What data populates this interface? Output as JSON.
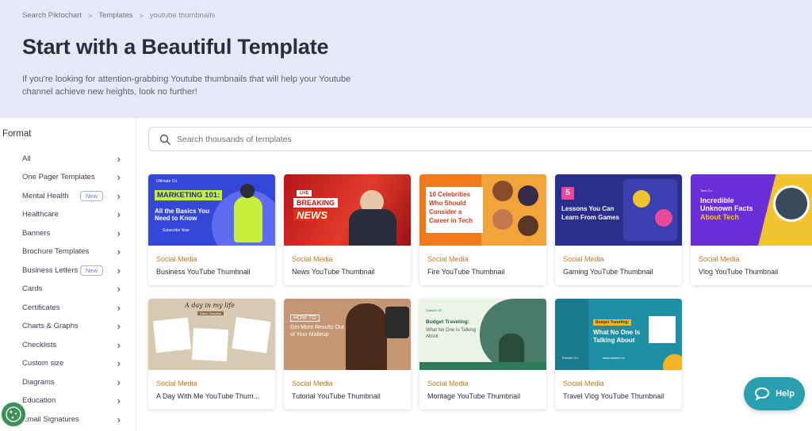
{
  "breadcrumb": {
    "items": [
      "Search Piktochart",
      "Templates",
      "youtube thumbnails"
    ]
  },
  "hero": {
    "title": "Start with a Beautiful Template",
    "description": "If you're looking for attention-grabbing Youtube thumbnails that will help your Youtube channel achieve new heights, look no further!"
  },
  "sidebar": {
    "heading": "Format",
    "items": [
      {
        "label": "All",
        "badge": ""
      },
      {
        "label": "One Pager Templates",
        "badge": ""
      },
      {
        "label": "Mental Health",
        "badge": "New"
      },
      {
        "label": "Healthcare",
        "badge": ""
      },
      {
        "label": "Banners",
        "badge": ""
      },
      {
        "label": "Brochure Templates",
        "badge": ""
      },
      {
        "label": "Business Letters",
        "badge": "New"
      },
      {
        "label": "Cards",
        "badge": ""
      },
      {
        "label": "Certificates",
        "badge": ""
      },
      {
        "label": "Charts & Graphs",
        "badge": ""
      },
      {
        "label": "Checklists",
        "badge": ""
      },
      {
        "label": "Custom size",
        "badge": ""
      },
      {
        "label": "Diagrams",
        "badge": ""
      },
      {
        "label": "Education",
        "badge": ""
      },
      {
        "label": "Email Signatures",
        "badge": ""
      }
    ]
  },
  "search": {
    "placeholder": "Search thousands of templates"
  },
  "templates": [
    {
      "category": "Social Media",
      "title": "Business YouTube Thumbnail",
      "thumb": {
        "brand": "Ultimate Co.",
        "headline": "MARKETING 101:",
        "sub": "All the Basics You Need to Know",
        "cta": "Subscribe Now"
      }
    },
    {
      "category": "Social Media",
      "title": "News YouTube Thumbnail",
      "thumb": {
        "tag": "LIVE",
        "headline": "BREAKING",
        "sub": "NEWS"
      }
    },
    {
      "category": "Social Media",
      "title": "Fire YouTube Thumbnail",
      "thumb": {
        "headline": "10 Celebrities Who Should Consider a Career in Tech"
      }
    },
    {
      "category": "Social Media",
      "title": "Gaming YouTube Thumbnail",
      "thumb": {
        "number": "5",
        "headline": "Lessons You Can Learn From Games"
      }
    },
    {
      "category": "Social Media",
      "title": "Vlog YouTube Thumbnail",
      "thumb": {
        "brand": "Tech Co.",
        "headline": "Incredible Unknown Facts",
        "accent": "About Tech"
      }
    },
    {
      "category": "Social Media",
      "title": "A Day With Me YouTube Thum...",
      "thumb": {
        "headline": "A day in my life",
        "sub": "Diana Oswalda"
      }
    },
    {
      "category": "Social Media",
      "title": "Tutorial YouTube Thumbnail",
      "thumb": {
        "tag": "HOW TO",
        "headline": "Get More Results Out of Your Makeup"
      }
    },
    {
      "category": "Social Media",
      "title": "Montage YouTube Thumbnail",
      "thumb": {
        "tag": "Episode 00",
        "headline": "Budget Traveling:",
        "sub": "What No One Is Talking About"
      }
    },
    {
      "category": "Social Media",
      "title": "Travel Vlog YouTube Thumbnail",
      "thumb": {
        "tag": "Budget Traveling:",
        "headline": "What No One Is Talking About",
        "brand": "Traveler Co.",
        "url": "www.traveler.co"
      }
    }
  ],
  "help": {
    "label": "Help"
  },
  "colors": {
    "hero_bg": "#e7e8f5",
    "category": "#c47a1e",
    "help_bg": "#2a9fb0"
  }
}
